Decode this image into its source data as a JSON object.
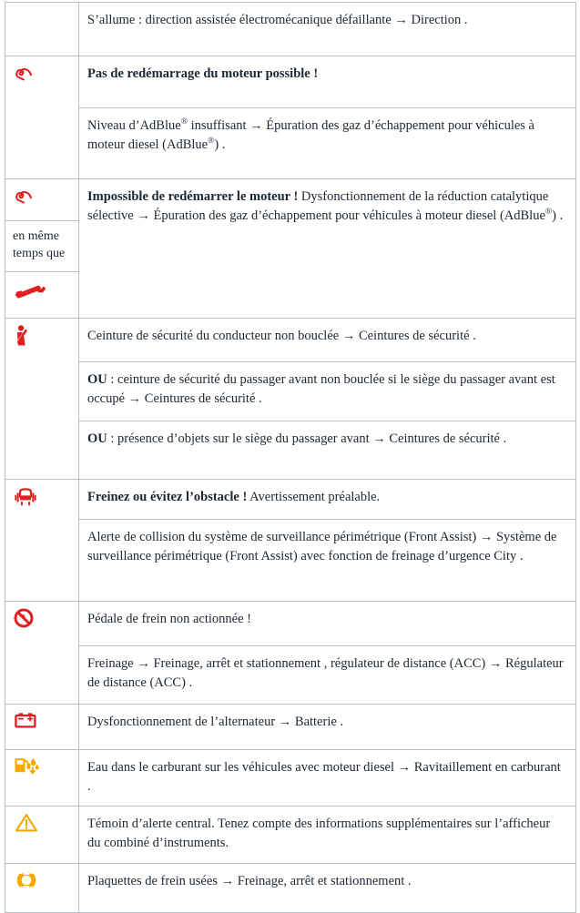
{
  "document": {
    "type": "vehicle-warning-lights-table",
    "language": "fr",
    "colors": {
      "red": "#e02020",
      "red_dark": "#cc1f1f",
      "amber": "#f5a800",
      "amber_dark": "#e09b00",
      "border": "#b9bec4",
      "text": "#1b2733",
      "background": "#ffffff"
    },
    "columns": [
      "icon",
      "description"
    ]
  },
  "rows": [
    {
      "id": "steering",
      "icons": [],
      "paragraphs": [
        {
          "id": "steering-p1",
          "bold": "",
          "text": "S’allume : direction assistée électromécanique défaillante  → Direction  ."
        }
      ]
    },
    {
      "id": "adblue-no-restart",
      "icons": [
        {
          "name": "adblue-exhaust-icon",
          "color": "#e02020",
          "label": "AdBlue exhaust warning"
        }
      ],
      "paragraphs": [
        {
          "id": "adblue-p1",
          "bold": "Pas de redémarrage du moteur possible !",
          "text": ""
        },
        {
          "id": "adblue-p2",
          "bold": "",
          "text": "Niveau d’AdBlue® insuffisant  → Épuration des gaz d’échappement pour véhicules à moteur diesel (AdBlue®)  ."
        }
      ]
    },
    {
      "id": "adblue-scr",
      "icons": [
        {
          "name": "adblue-exhaust-icon",
          "color": "#e02020",
          "label": "AdBlue exhaust warning"
        },
        {
          "name": "en-meme-temps-que-label",
          "color": "",
          "label": "en même temps que"
        },
        {
          "name": "wrench-icon",
          "color": "#e02020",
          "label": "Service wrench"
        }
      ],
      "connector_text": "en même temps que",
      "paragraphs": [
        {
          "id": "scr-p1",
          "bold": "Impossible de redémarrer le moteur !",
          "text": " Dysfonctionnement de la réduction catalytique sélective  → Épuration des gaz d’échappement pour véhicules à moteur diesel (AdBlue®)  ."
        }
      ]
    },
    {
      "id": "seatbelt",
      "icons": [
        {
          "name": "seatbelt-icon",
          "color": "#e02020",
          "label": "Seat belt reminder"
        }
      ],
      "paragraphs": [
        {
          "id": "belt-p1",
          "bold": "",
          "text": "Ceinture de sécurité du conducteur non bouclée  → Ceintures de sécurité  ."
        },
        {
          "id": "belt-p2",
          "bold": "OU",
          "text": " : ceinture de sécurité du passager avant non bouclée si le siège du passager avant est occupé  → Ceintures de sécurité  ."
        },
        {
          "id": "belt-p3",
          "bold": "OU",
          "text": " : présence d’objets sur le siège du passager avant  → Ceintures de sécurité  ."
        }
      ]
    },
    {
      "id": "front-assist",
      "icons": [
        {
          "name": "front-assist-icon",
          "color": "#e02020",
          "label": "Front Assist collision warning"
        }
      ],
      "paragraphs": [
        {
          "id": "fa-p1",
          "bold": "Freinez ou évitez l’obstacle !",
          "text": " Avertissement préalable."
        },
        {
          "id": "fa-p2",
          "bold": "",
          "text": "Alerte de collision du système de surveillance périmétrique (Front Assist)  → Système de surveillance périmétrique (Front Assist) avec fonction de freinage d’urgence City  ."
        }
      ]
    },
    {
      "id": "brake-pedal",
      "icons": [
        {
          "name": "brake-pedal-icon",
          "color": "#e02020",
          "label": "Brake pedal not pressed"
        }
      ],
      "paragraphs": [
        {
          "id": "bp-p1",
          "bold": "",
          "text": "Pédale de frein non actionnée !"
        },
        {
          "id": "bp-p2",
          "bold": "",
          "text": "Freinage  → Freinage, arrêt et stationnement  , régulateur de distance (ACC)  → Régulateur de distance (ACC)  ."
        }
      ]
    },
    {
      "id": "alternator",
      "icons": [
        {
          "name": "battery-icon",
          "color": "#e02020",
          "label": "Battery / alternator"
        }
      ],
      "paragraphs": [
        {
          "id": "alt-p1",
          "bold": "",
          "text": "Dysfonctionnement de l’alternateur  → Batterie  ."
        }
      ]
    },
    {
      "id": "water-in-fuel",
      "icons": [
        {
          "name": "water-in-fuel-icon",
          "color": "#f5a800",
          "label": "Water in fuel"
        }
      ],
      "paragraphs": [
        {
          "id": "wf-p1",
          "bold": "",
          "text": "Eau dans le carburant sur les véhicules avec moteur diesel  → Ravitaillement en carburant  ."
        }
      ]
    },
    {
      "id": "central-warning",
      "icons": [
        {
          "name": "warning-triangle-icon",
          "color": "#f5a800",
          "label": "Central warning"
        }
      ],
      "paragraphs": [
        {
          "id": "cw-p1",
          "bold": "",
          "text": "Témoin d’alerte central. Tenez compte des informations supplémentaires sur l’afficheur du combiné d’instruments."
        }
      ]
    },
    {
      "id": "brake-pads",
      "icons": [
        {
          "name": "brake-pad-wear-icon",
          "color": "#f5a800",
          "label": "Brake pad wear"
        }
      ],
      "paragraphs": [
        {
          "id": "bpad-p1",
          "bold": "",
          "text": "Plaquettes de frein usées  → Freinage, arrêt et stationnement  ."
        }
      ]
    }
  ]
}
